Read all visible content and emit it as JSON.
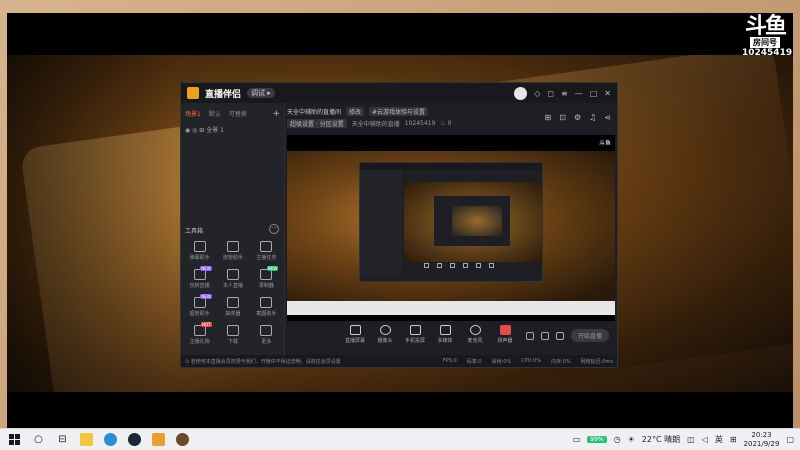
{
  "stream_logo": {
    "mark": "斗鱼",
    "room_label": "房间号",
    "room_number": "10245419"
  },
  "app": {
    "name": "直播伴侣",
    "version_chip": "调试 ▸",
    "title_icons": [
      "gift-icon",
      "shirt-icon",
      "menu-icon",
      "minimize-icon",
      "maximize-icon",
      "close-icon"
    ]
  },
  "sidebar": {
    "tabs": [
      "场景1",
      "默认",
      "可替换"
    ],
    "active_tab": 0,
    "add_label": "+",
    "scene_name": "◉  ◎  ⊞  全景 1",
    "tools_title": "工具箱",
    "tools_more": "···",
    "tools": [
      {
        "label": "弹幕助手",
        "badge": ""
      },
      {
        "label": "房管助手",
        "badge": ""
      },
      {
        "label": "主播任务",
        "badge": ""
      },
      {
        "label": "玩转直播",
        "badge": "NEW",
        "badge_color": "purple"
      },
      {
        "label": "本人直播",
        "badge": ""
      },
      {
        "label": "录制器",
        "badge": "NEW",
        "badge_color": "green"
      },
      {
        "label": "超管助手",
        "badge": "NEW",
        "badge_color": "purple"
      },
      {
        "label": "抽奖器",
        "badge": ""
      },
      {
        "label": "截图助手",
        "badge": ""
      },
      {
        "label": "主播礼物",
        "badge": "HOT",
        "badge_color": "red"
      },
      {
        "label": "下载",
        "badge": ""
      },
      {
        "label": "更多",
        "badge": ""
      }
    ]
  },
  "info": {
    "title": "天全中辅助的直播间",
    "chip1": "修改",
    "chip2": "#云游戏体验与设置",
    "category": "超级设置 · 分区设置",
    "room_link": "天全中辅助的直播",
    "room_id": "10245419",
    "hot": "♨ 0",
    "right_icons": [
      "share-screen-icon",
      "lock-icon",
      "settings-icon",
      "bell-icon",
      "share-icon"
    ]
  },
  "preview": {
    "logo_text": "斗鱼"
  },
  "controls": {
    "items": [
      {
        "label": "直播屏幕",
        "icon": "screen-share-icon",
        "style": ""
      },
      {
        "label": "摄像头",
        "icon": "camera-icon",
        "style": "round"
      },
      {
        "label": "手机投屏",
        "icon": "phone-cast-icon",
        "style": ""
      },
      {
        "label": "多媒体",
        "icon": "media-icon",
        "style": ""
      },
      {
        "label": "麦克风",
        "icon": "microphone-icon",
        "style": "round"
      },
      {
        "label": "扬声器",
        "icon": "speaker-icon",
        "style": "red"
      }
    ],
    "live_button": "开始直播"
  },
  "status_bar": {
    "notice": "⊙ 若使用本直播会员权限与我们，开播中不保证流畅。请前往会员设置",
    "items": [
      "FPS:0",
      "码率:0",
      "丢帧:0%",
      "CPU:0%",
      "内存:0%",
      "网络延迟:0ms"
    ]
  },
  "taskbar": {
    "battery": "99%",
    "weather": "22°C 晴朗",
    "lang": "英",
    "time": "20:23",
    "date": "2021/9/29"
  }
}
